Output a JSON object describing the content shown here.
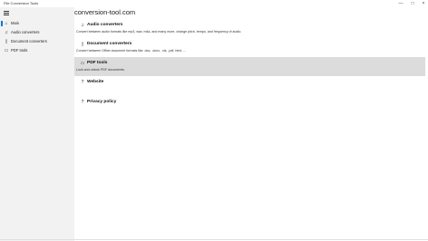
{
  "window": {
    "title": "File Conversion Tools",
    "minimize_glyph": "—",
    "maximize_glyph": "□",
    "close_glyph": "×"
  },
  "sidebar": {
    "items": [
      {
        "label": "Main",
        "icon": "home-icon",
        "glyph": "⌂",
        "selected": true
      },
      {
        "label": "Audio converters",
        "icon": "music-icon",
        "glyph": "♫",
        "selected": false
      },
      {
        "label": "Document converters",
        "icon": "document-icon",
        "glyph": "▯",
        "selected": false
      },
      {
        "label": "PDF tools",
        "icon": "pdf-icon",
        "glyph": "▭",
        "selected": false
      }
    ],
    "accent_color": "#0078d7"
  },
  "main": {
    "title": "conversion-tool.com",
    "tiles": [
      {
        "title": "Audio converters",
        "description": "Convert between audio formats like mp3, wav, m4a, and many more, change pitch, tempo, and frequency of audio.",
        "icon": "music-icon",
        "glyph": "♫",
        "selected": false
      },
      {
        "title": "Document converters",
        "description": "Convert between Office document formats like .doc, .docx, .xls, .pdf, html, ...",
        "icon": "document-icon",
        "glyph": "▯",
        "selected": false
      },
      {
        "title": "PDF tools",
        "description": "Lock and unlock PDF documents.",
        "icon": "pdf-icon",
        "glyph": "▭",
        "selected": true
      },
      {
        "title": "Website",
        "description": "",
        "icon": "help-icon",
        "glyph": "?",
        "selected": false
      },
      {
        "title": "Privacy policy",
        "description": "",
        "icon": "help-icon",
        "glyph": "?",
        "selected": false
      }
    ]
  }
}
